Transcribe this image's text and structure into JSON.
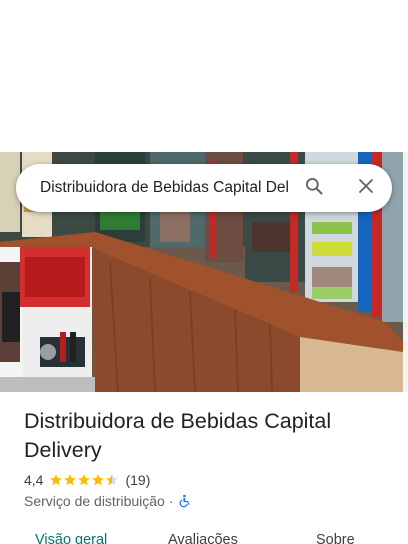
{
  "search": {
    "query": "Distribuidora de Bebidas Capital Delivery"
  },
  "place": {
    "name": "Distribuidora de Bebidas Capital Delivery",
    "rating": "4,4",
    "rating_value": 4.4,
    "stars_max": 5,
    "review_count": "(19)",
    "category": "Serviço de distribuição",
    "separator": "·"
  },
  "tabs": [
    {
      "label": "Visão geral",
      "active": true
    },
    {
      "label": "Avaliações",
      "active": false
    },
    {
      "label": "Sobre",
      "active": false
    }
  ],
  "icons": {
    "search": "search-icon",
    "close": "close-icon",
    "star": "star-icon",
    "accessibility": "wheelchair-icon"
  },
  "colors": {
    "star": "#fbbc04",
    "active_tab": "#00796b",
    "accessibility": "#1a73e8"
  }
}
